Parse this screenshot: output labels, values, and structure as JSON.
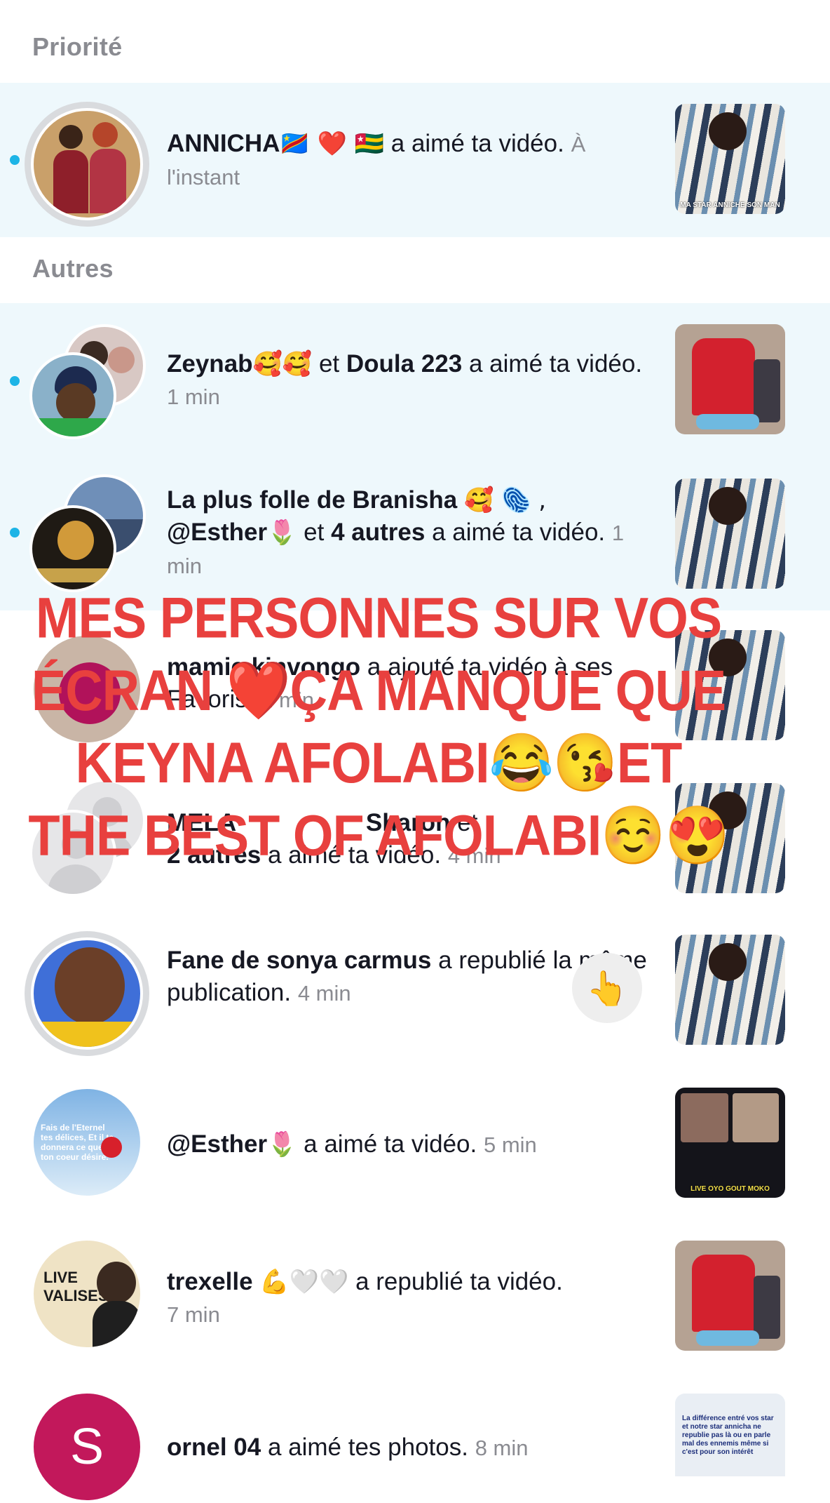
{
  "sections": {
    "priority": "Priorité",
    "others": "Autres"
  },
  "notifications": [
    {
      "name": "ANNICHA",
      "emojis": "🇨🇩 ❤️ 🇹🇬",
      "action": "a aimé ta vidéo.",
      "time": "À l'instant",
      "unread": true
    },
    {
      "name1": "Zeynab",
      "emojis1": "🥰🥰",
      "joiner": "et",
      "name2": "Doula  223",
      "action": "a aimé ta vidéo.",
      "time": "1 min",
      "unread": true
    },
    {
      "name1": "La plus folle de Branisha",
      "emojis1": "🥰 🫆 ,",
      "name2": "@Esther",
      "emojis2": "🌷",
      "joiner": "et",
      "others": "4 autres",
      "action": "a aimé ta vidéo.",
      "time": "1 min",
      "unread": true
    },
    {
      "name": "mamie kinvongo",
      "action": "a ajouté ta vidéo à ses Favoris.",
      "time": "1 min"
    },
    {
      "name1": "MELA",
      "name2": "Sharon",
      "joiner": "et",
      "others": "2 autres",
      "action": "a aimé ta vidéo.",
      "time": "4 min"
    },
    {
      "name": "Fane de sonya carmus",
      "action": "a republié la même publication.",
      "time": "4 min",
      "wave": "👆"
    },
    {
      "name": "@Esther",
      "emojis": "🌷",
      "action": "a aimé ta vidéo.",
      "time": "5 min"
    },
    {
      "name": "trexelle",
      "emojis": "💪🤍🤍",
      "action": "a republié ta vidéo.",
      "time": "7 min"
    },
    {
      "name": "ornel 04",
      "action": "a aimé tes photos.",
      "time": "8 min",
      "avatar_letter": "S"
    }
  ],
  "thumb_captions": {
    "annicha": "MA STAR ANNICHE SON MAN",
    "esther": "LIVE OYO GOUT MOKO",
    "ornel": "La différence entré vos star et notre star annicha ne republie pas là ou en parle mal des ennemis même si c'est pour son intérêt",
    "esther_avatar": "Fais de l'Eternel tes délices, Et il te donnera ce que ton coeur désire.",
    "trexelle_avatar": "LIVE VALISES"
  },
  "overlay_text": "Mes personnes sur vos écran ❤️ça manque que Keyna Afolabi😂😘et the best of Afolabi☺️😍",
  "colors": {
    "unread_bg": "#eef8fc",
    "unread_dot": "#1db4e6",
    "overlay_red": "#e8403e",
    "ornel_avatar": "#c2185b"
  }
}
